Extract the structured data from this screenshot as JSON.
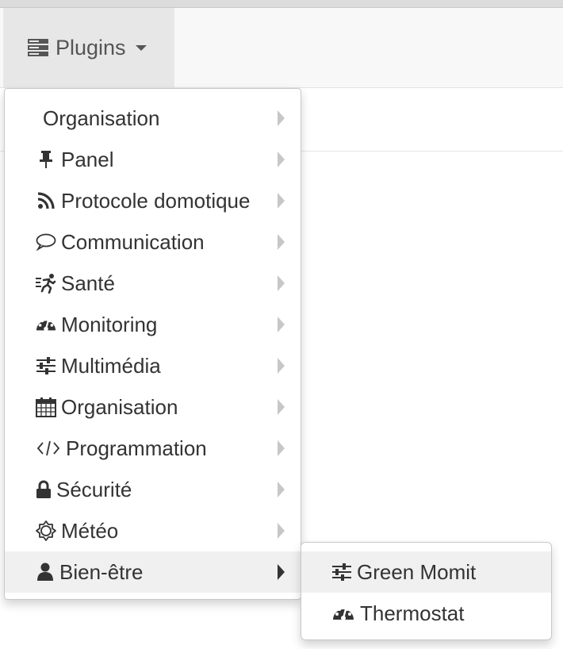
{
  "navbar": {
    "plugins_label": "Plugins"
  },
  "menu": {
    "items": [
      {
        "label": "Organisation",
        "icon": "none"
      },
      {
        "label": "Panel",
        "icon": "thumbtack-icon"
      },
      {
        "label": "Protocole domotique",
        "icon": "rss-icon"
      },
      {
        "label": "Communication",
        "icon": "comment-icon"
      },
      {
        "label": "Santé",
        "icon": "running-icon"
      },
      {
        "label": "Monitoring",
        "icon": "dashboard-icon"
      },
      {
        "label": "Multimédia",
        "icon": "sliders-icon"
      },
      {
        "label": "Organisation",
        "icon": "calendar-icon"
      },
      {
        "label": "Programmation",
        "icon": "code-icon"
      },
      {
        "label": "Sécurité",
        "icon": "lock-icon"
      },
      {
        "label": "Météo",
        "icon": "sun-icon"
      },
      {
        "label": "Bien-être",
        "icon": "user-icon",
        "active": true
      }
    ]
  },
  "submenu": {
    "items": [
      {
        "label": "Green Momit",
        "icon": "sliders-icon",
        "active": true
      },
      {
        "label": "Thermostat",
        "icon": "dashboard-icon"
      }
    ]
  },
  "colors": {
    "text": "#333333",
    "hover_bg": "#f0f0f0",
    "navbar_bg": "#f8f8f8",
    "active_nav_bg": "#e7e7e7"
  }
}
